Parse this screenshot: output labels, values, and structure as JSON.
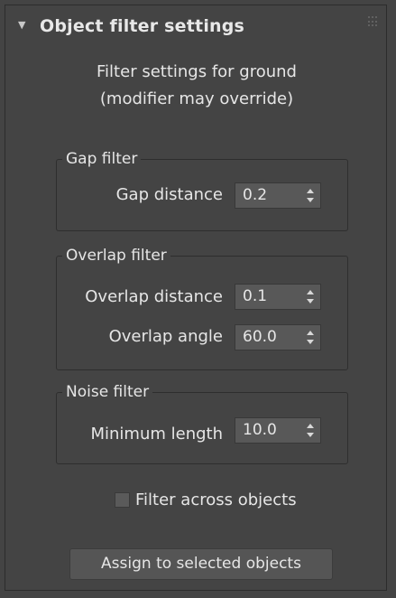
{
  "header": {
    "title": "Object filter settings"
  },
  "subtitle": {
    "line1": "Filter settings for ground",
    "line2": "(modifier may override)"
  },
  "groups": {
    "gap": {
      "title": "Gap filter",
      "fields": [
        {
          "label": "Gap distance",
          "value": "0.2"
        }
      ]
    },
    "overlap": {
      "title": "Overlap filter",
      "fields": [
        {
          "label": "Overlap distance",
          "value": "0.1"
        },
        {
          "label": "Overlap angle",
          "value": "60.0"
        }
      ]
    },
    "noise": {
      "title": "Noise filter",
      "fields": [
        {
          "label": "Minimum length",
          "value": "10.0"
        }
      ]
    }
  },
  "checkbox": {
    "label": "Filter across objects",
    "checked": false
  },
  "button": {
    "label": "Assign to selected objects"
  },
  "colors": {
    "panel_bg": "#444444",
    "text": "#e6e6e6",
    "field_bg": "#585858",
    "border": "#2e2e2e"
  }
}
